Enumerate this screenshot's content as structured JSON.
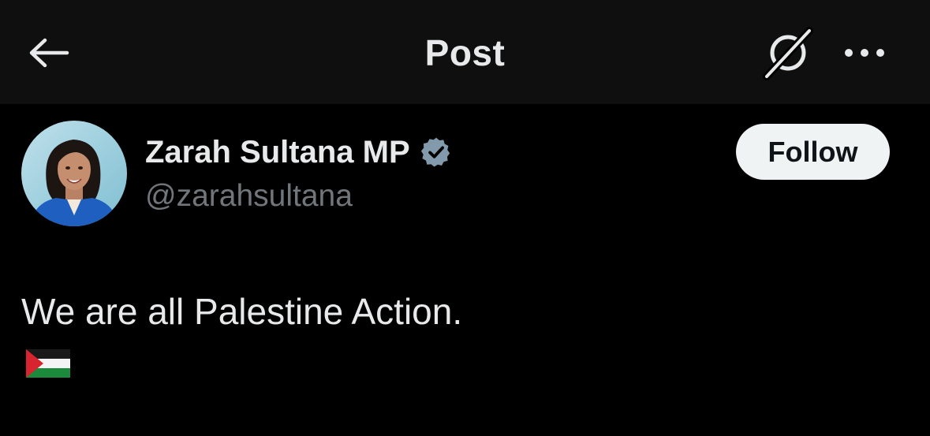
{
  "header": {
    "title": "Post",
    "back_icon": "arrow-left-icon",
    "grok_icon": "grok-icon",
    "more_icon": "ellipsis-icon"
  },
  "author": {
    "display_name": "Zarah Sultana MP",
    "handle": "@zarahsultana",
    "verified": true,
    "verified_color": "#829aab",
    "avatar_icon": "profile-photo"
  },
  "follow": {
    "label": "Follow"
  },
  "post": {
    "text": "We are all Palestine Action.",
    "emoji": "palestine-flag-emoji"
  },
  "colors": {
    "background": "#000000",
    "header_background": "#0f0f0f",
    "primary_text": "#e7e9ea",
    "secondary_text": "#71767b",
    "follow_bg": "#eff3f4",
    "follow_text": "#0f1419"
  }
}
